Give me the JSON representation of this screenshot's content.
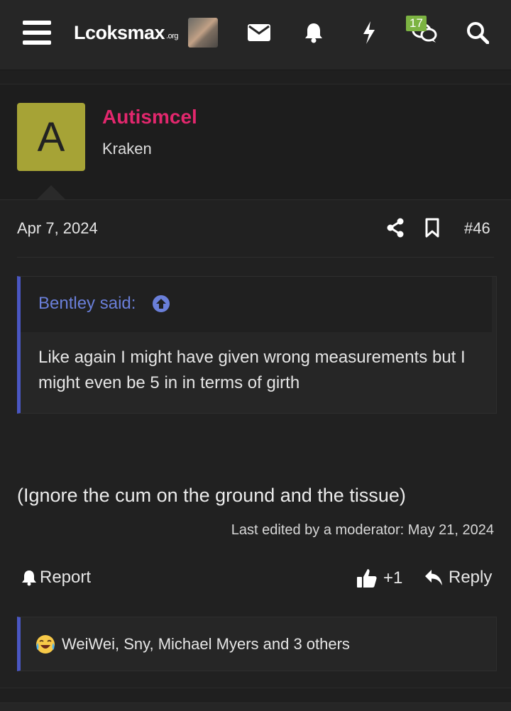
{
  "header": {
    "logo_text": "Lcoksmax",
    "logo_suffix": ".org",
    "notification_count": "17",
    "icons": [
      "menu-icon",
      "avatar",
      "envelope-icon",
      "bell-icon",
      "bolt-icon",
      "chat-icon",
      "search-icon"
    ]
  },
  "post": {
    "author": {
      "initial": "A",
      "name": "Autismcel",
      "title": "Kraken",
      "avatar_color": "#a6a336",
      "name_color": "#e2276d"
    },
    "date": "Apr 7, 2024",
    "number": "#46",
    "quote": {
      "author": "Bentley said:",
      "text": "Like again I might have given wrong measurements but I might even be 5 in in terms of girth"
    },
    "message": "(Ignore the cum on the ground and the tissue)",
    "edited": "Last edited by a moderator: May 21, 2024",
    "actions": {
      "report": "Report",
      "like_count": "+1",
      "reply": "Reply"
    },
    "reactions": {
      "users": "WeiWei, Sny, Michael Myers and 3 others"
    }
  },
  "colors": {
    "background": "#1f1f1f",
    "topbar": "#262626",
    "accent_blue": "#4a57c3",
    "quote_author": "#6a7fd9",
    "badge_green": "#7cb342"
  }
}
